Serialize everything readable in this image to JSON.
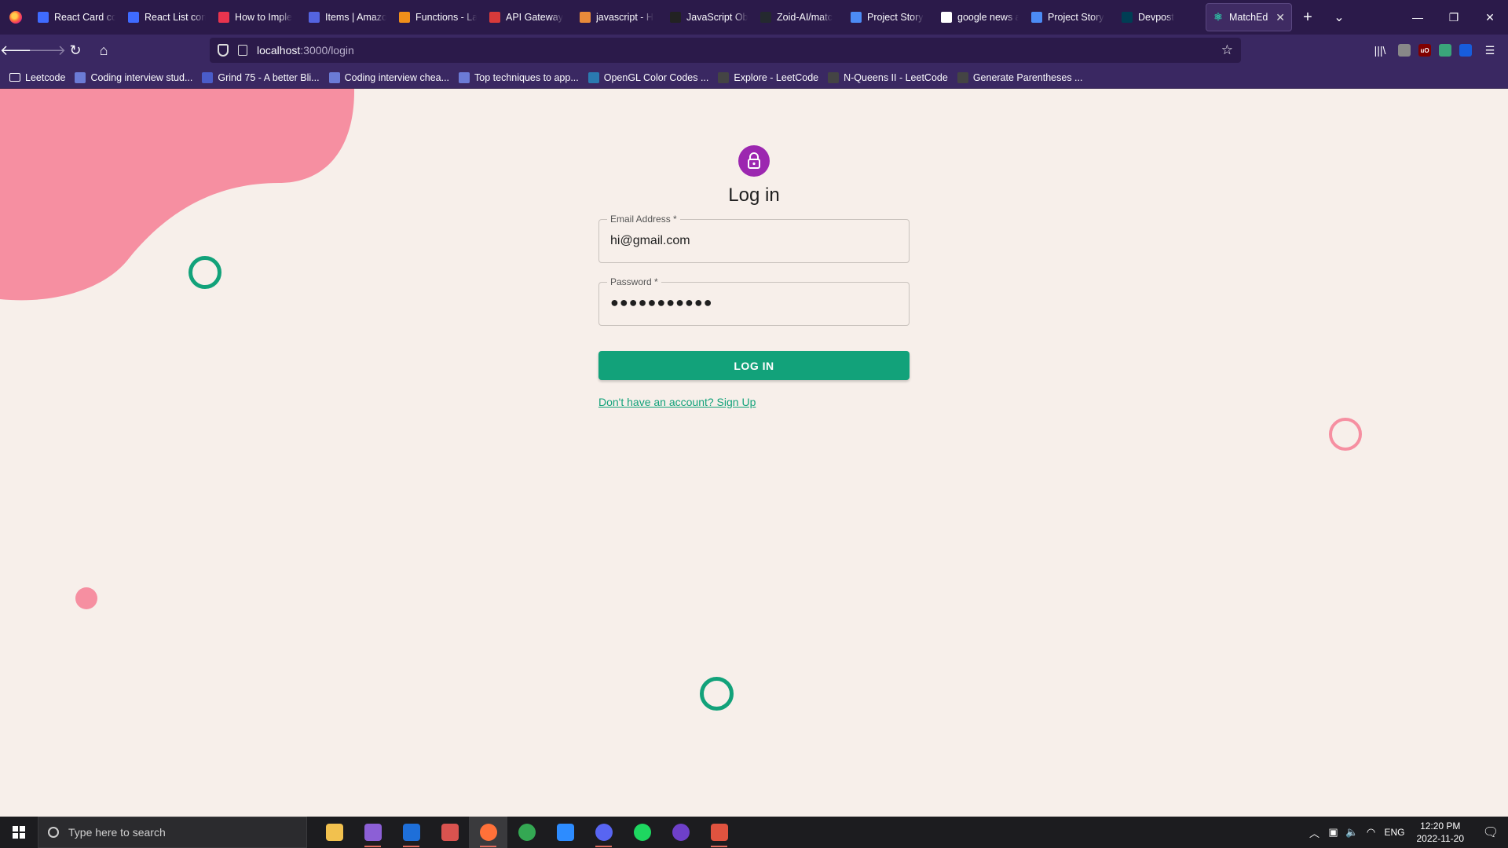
{
  "browser": {
    "tabs": [
      {
        "title": "React Card co",
        "icon": "react-docs-icon",
        "color": "#3f6bff"
      },
      {
        "title": "React List con",
        "icon": "react-docs-icon",
        "color": "#3f6bff"
      },
      {
        "title": "How to Imple",
        "icon": "youtube-icon",
        "color": "#e8344e"
      },
      {
        "title": "Items | Amazo",
        "icon": "aws-dynamodb-icon",
        "color": "#5464e0"
      },
      {
        "title": "Functions - La",
        "icon": "aws-lambda-icon",
        "color": "#f08f1a"
      },
      {
        "title": "API Gateway",
        "icon": "aws-api-gateway-icon",
        "color": "#d83a3a"
      },
      {
        "title": "javascript - H",
        "icon": "stackoverflow-icon",
        "color": "#e88a3a"
      },
      {
        "title": "JavaScript Ob",
        "icon": "javascript-docs-icon",
        "color": "#222222"
      },
      {
        "title": "Zoid-AI/matc",
        "icon": "github-icon",
        "color": "#24292f"
      },
      {
        "title": "Project Story",
        "icon": "google-docs-icon",
        "color": "#4c8bf5"
      },
      {
        "title": "google news a",
        "icon": "google-icon",
        "color": "#ffffff"
      },
      {
        "title": "Project Story",
        "icon": "google-docs-icon",
        "color": "#4c8bf5"
      },
      {
        "title": "Devpost",
        "icon": "devpost-icon",
        "color": "#003e54"
      }
    ],
    "active_tab": {
      "title": "MatchEd",
      "icon": "react-icon",
      "close": "✕"
    },
    "new_tab": "+",
    "tab_list": "⌄",
    "window": {
      "minimize": "—",
      "restore": "❐",
      "close": "✕"
    },
    "url": {
      "host": "localhost",
      "path": ":3000/login"
    },
    "bookmarks": [
      {
        "label": "Leetcode",
        "icon": "folder-icon"
      },
      {
        "label": "Coding interview stud...",
        "icon": "code-icon"
      },
      {
        "label": "Grind 75 - A better Bli...",
        "icon": "grind75-icon"
      },
      {
        "label": "Coding interview chea...",
        "icon": "code-icon"
      },
      {
        "label": "Top techniques to app...",
        "icon": "code-icon"
      },
      {
        "label": "OpenGL Color Codes ...",
        "icon": "wordpress-icon"
      },
      {
        "label": "Explore - LeetCode",
        "icon": "leetcode-icon"
      },
      {
        "label": "N-Queens II - LeetCode",
        "icon": "leetcode-icon"
      },
      {
        "label": "Generate Parentheses ...",
        "icon": "leetcode-icon"
      }
    ]
  },
  "login": {
    "title": "Log in",
    "email_label": "Email Address *",
    "email_value": "hi@gmail.com",
    "password_label": "Password *",
    "password_value": "●●●●●●●●●●●",
    "button": "LOG IN",
    "signup_link": "Don't have an account? Sign Up"
  },
  "colors": {
    "accent": "#12a27a",
    "avatar": "#9c27b0",
    "blob": "#f68fa1",
    "background": "#f7efea"
  },
  "taskbar": {
    "search_placeholder": "Type here to search",
    "apps": [
      {
        "name": "file-explorer-icon",
        "color": "#f2c14e"
      },
      {
        "name": "visual-studio-icon",
        "color": "#8c5fd6"
      },
      {
        "name": "intellij-icon",
        "color": "#1e6fd9"
      },
      {
        "name": "windows-store-icon",
        "color": "#d9534f"
      },
      {
        "name": "firefox-icon",
        "color": "#ff7139"
      },
      {
        "name": "chrome-icon",
        "color": "#34a853"
      },
      {
        "name": "zoom-icon",
        "color": "#2d8cff"
      },
      {
        "name": "discord-icon",
        "color": "#5865f2"
      },
      {
        "name": "spotify-icon",
        "color": "#1ed760"
      },
      {
        "name": "github-desktop-icon",
        "color": "#6e40c9"
      },
      {
        "name": "git-extensions-icon",
        "color": "#e0533f"
      }
    ],
    "language": "ENG",
    "time": "12:20 PM",
    "date": "2022-11-20"
  }
}
